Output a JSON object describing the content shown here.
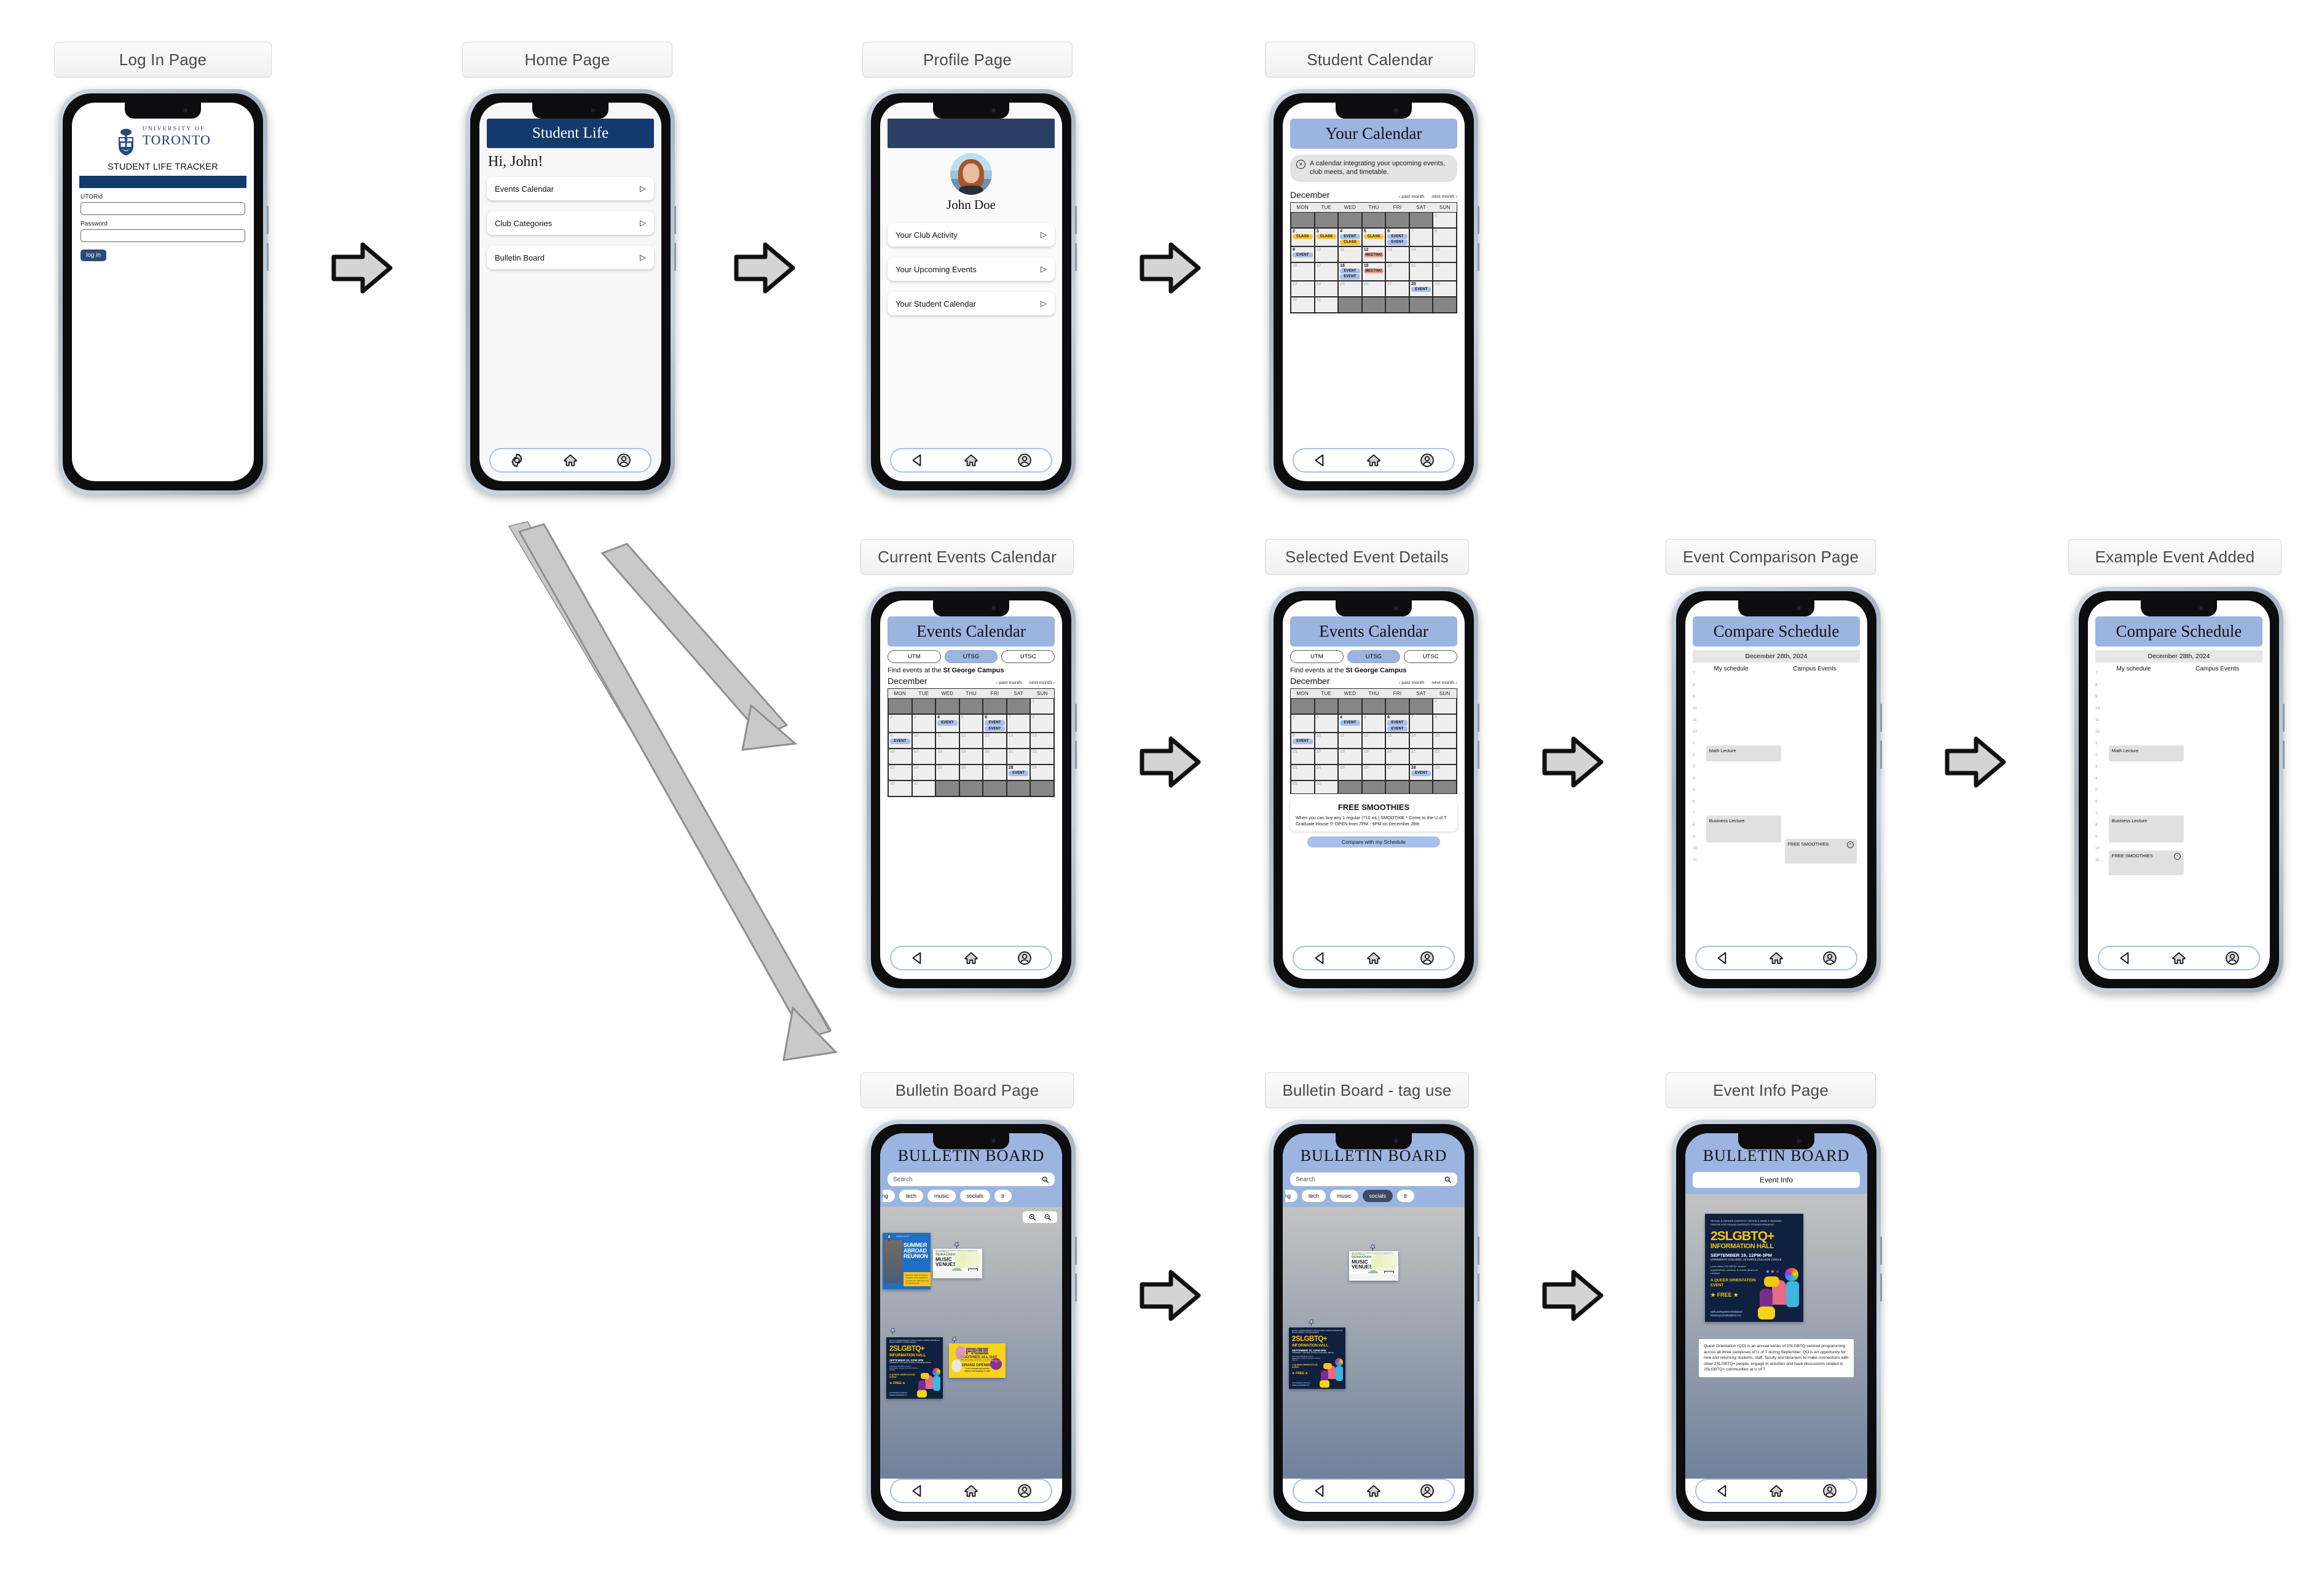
{
  "flow": {
    "labels": {
      "login": "Log In Page",
      "home": "Home Page",
      "profile": "Profile Page",
      "student_calendar": "Student Calendar",
      "current_events": "Current Events Calendar",
      "selected_event": "Selected Event Details",
      "event_comparison": "Event Comparison Page",
      "example_added": "Example Event Added",
      "bulletin": "Bulletin Board Page",
      "bulletin_tag": "Bulletin Board - tag use",
      "event_info": "Event Info Page"
    }
  },
  "login": {
    "university_line1": "UNIVERSITY OF",
    "university_line2": "TORONTO",
    "app_title": "STUDENT LIFE TRACKER",
    "utorid_label": "UTORid",
    "utorid_value": "",
    "password_label": "Password",
    "password_value": "",
    "login_button": "log in"
  },
  "home": {
    "header": "Student Life",
    "greeting": "Hi, John!",
    "items": [
      {
        "label": "Events Calendar"
      },
      {
        "label": "Club Categories"
      },
      {
        "label": "Bulletin Board"
      }
    ],
    "nav": [
      "gear-icon",
      "home-icon",
      "profile-icon"
    ]
  },
  "profile": {
    "name": "John Doe",
    "items": [
      {
        "label": "Your Club Activity"
      },
      {
        "label": "Your Upcoming Events"
      },
      {
        "label": "Your Student Calendar"
      }
    ]
  },
  "student_calendar": {
    "header": "Your Calendar",
    "note": "A calendar integrating your upcoming events, club meets, and timetable.",
    "month": "December",
    "prev": "‹ past month",
    "next": "next month ›",
    "dow": [
      "MON",
      "TUE",
      "WED",
      "THU",
      "FRI",
      "SAT",
      "SUN"
    ],
    "weeks": [
      [
        {
          "off": true
        },
        {
          "off": true
        },
        {
          "off": true
        },
        {
          "off": true
        },
        {
          "off": true
        },
        {
          "off": true
        },
        {
          "d": "1",
          "dim": true
        }
      ],
      [
        {
          "d": "2",
          "tags": [
            {
              "t": "CLASS",
              "k": "cl"
            }
          ]
        },
        {
          "d": "3",
          "tags": [
            {
              "t": "CLASS",
              "k": "cl"
            }
          ]
        },
        {
          "d": "4",
          "tags": [
            {
              "t": "EVENT",
              "k": "ev"
            },
            {
              "t": "CLASS",
              "k": "cl"
            }
          ]
        },
        {
          "d": "5",
          "tags": [
            {
              "t": "CLASS",
              "k": "cl"
            }
          ]
        },
        {
          "d": "6",
          "tags": [
            {
              "t": "EVENT",
              "k": "ev"
            },
            {
              "t": "EVENT",
              "k": "ev"
            }
          ]
        },
        {
          "d": "7",
          "dim": true
        },
        {
          "d": "8",
          "dim": true
        }
      ],
      [
        {
          "d": "9",
          "tags": [
            {
              "t": "EVENT",
              "k": "ev"
            }
          ]
        },
        {
          "d": "10",
          "dim": true
        },
        {
          "d": "11",
          "dim": true
        },
        {
          "d": "12",
          "tags": [
            {
              "t": "MEETING",
              "k": "mt"
            }
          ]
        },
        {
          "d": "13",
          "dim": true
        },
        {
          "d": "14",
          "dim": true
        },
        {
          "d": "15",
          "dim": true
        }
      ],
      [
        {
          "d": "16",
          "dim": true
        },
        {
          "d": "17",
          "dim": true
        },
        {
          "d": "18",
          "tags": [
            {
              "t": "EVENT",
              "k": "ev"
            },
            {
              "t": "EVENT",
              "k": "ev"
            }
          ]
        },
        {
          "d": "19",
          "tags": [
            {
              "t": "MEETING",
              "k": "mt"
            }
          ]
        },
        {
          "d": "20",
          "dim": true
        },
        {
          "d": "21",
          "dim": true
        },
        {
          "d": "22",
          "dim": true
        }
      ],
      [
        {
          "d": "23",
          "dim": true
        },
        {
          "d": "24",
          "dim": true
        },
        {
          "d": "25",
          "dim": true
        },
        {
          "d": "26",
          "dim": true
        },
        {
          "d": "27",
          "dim": true
        },
        {
          "d": "28",
          "tags": [
            {
              "t": "EVENT",
              "k": "ev"
            }
          ]
        },
        {
          "d": "29",
          "dim": true
        }
      ],
      [
        {
          "d": "30",
          "dim": true
        },
        {
          "d": "31",
          "dim": true
        },
        {
          "off": true
        },
        {
          "off": true
        },
        {
          "off": true
        },
        {
          "off": true
        },
        {
          "off": true
        }
      ]
    ]
  },
  "events_calendar": {
    "header": "Events Calendar",
    "campus_tabs": [
      "UTM",
      "UTSG",
      "UTSC"
    ],
    "selected_campus": "UTSG",
    "find_prefix": "Find events at the ",
    "campus_name": "St George Campus",
    "month": "December",
    "prev": "‹ past month",
    "next": "next month ›",
    "dow": [
      "MON",
      "TUE",
      "WED",
      "THU",
      "FRI",
      "SAT",
      "SUN"
    ],
    "weeks": [
      [
        {
          "off": true
        },
        {
          "off": true
        },
        {
          "off": true
        },
        {
          "off": true
        },
        {
          "off": true
        },
        {
          "off": true
        },
        {
          "d": "1",
          "dim": true
        }
      ],
      [
        {
          "d": "2",
          "dim": true
        },
        {
          "d": "3",
          "dim": true
        },
        {
          "d": "4",
          "tags": [
            {
              "t": "EVENT",
              "k": "ev"
            }
          ]
        },
        {
          "d": "5",
          "dim": true
        },
        {
          "d": "6",
          "tags": [
            {
              "t": "EVENT",
              "k": "ev"
            },
            {
              "t": "EVENT",
              "k": "ev"
            }
          ]
        },
        {
          "d": "7",
          "dim": true
        },
        {
          "d": "8",
          "dim": true
        }
      ],
      [
        {
          "d": "9",
          "dim": true,
          "tags": [
            {
              "t": "EVENT",
              "k": "ev"
            }
          ]
        },
        {
          "d": "10",
          "dim": true
        },
        {
          "d": "11",
          "dim": true
        },
        {
          "d": "12",
          "dim": true
        },
        {
          "d": "13",
          "dim": true
        },
        {
          "d": "14",
          "dim": true
        },
        {
          "d": "15",
          "dim": true
        }
      ],
      [
        {
          "d": "16",
          "dim": true
        },
        {
          "d": "17",
          "dim": true
        },
        {
          "d": "18",
          "dim": true
        },
        {
          "d": "19",
          "dim": true
        },
        {
          "d": "20",
          "dim": true
        },
        {
          "d": "21",
          "dim": true
        },
        {
          "d": "22",
          "dim": true
        }
      ],
      [
        {
          "d": "23",
          "dim": true
        },
        {
          "d": "24",
          "dim": true
        },
        {
          "d": "25",
          "dim": true
        },
        {
          "d": "26",
          "dim": true
        },
        {
          "d": "27",
          "dim": true
        },
        {
          "d": "28",
          "tags": [
            {
              "t": "EVENT",
              "k": "ev"
            }
          ]
        },
        {
          "d": "29",
          "dim": true
        }
      ],
      [
        {
          "d": "30",
          "dim": true
        },
        {
          "d": "31",
          "dim": true
        },
        {
          "off": true
        },
        {
          "off": true
        },
        {
          "off": true
        },
        {
          "off": true
        },
        {
          "off": true
        }
      ]
    ]
  },
  "selected_event": {
    "title": "FREE SMOOTHIES",
    "body": "When you can buy any 1 regular (710 mL) SMOOTHIE * Come to the U of T Graduate House !!! OPEN from 7PM - 9PM on December 28th",
    "compare_button": "Compare with my Schedule"
  },
  "compare": {
    "header": "Compare Schedule",
    "date": "December 28th, 2024",
    "col_mine": "My schedule",
    "col_campus": "Campus Events",
    "hours": [
      "7",
      "8",
      "9",
      "10",
      "11",
      "12",
      "1",
      "2",
      "3",
      "4",
      "5",
      "6",
      "7",
      "8",
      "9",
      "10",
      "11"
    ],
    "my_events": [
      {
        "label": "Math Lecture"
      },
      {
        "label": "Business Lecture"
      }
    ],
    "campus_events": [
      {
        "label": "FREE SMOOTHIES",
        "action": "+"
      }
    ],
    "added_events": [
      {
        "label": "FREE SMOOTHIES",
        "action": "−"
      }
    ]
  },
  "bulletin": {
    "header": "BULLETIN BOARD",
    "search_placeholder": "Search",
    "search_value": "",
    "tags": [
      "ing",
      "tech",
      "music",
      "socials",
      "tr"
    ],
    "selected_tag_board": "",
    "selected_tag_filtered": "socials",
    "zoom_in": "zoom-in-icon",
    "zoom_out": "zoom-out-icon",
    "posters": [
      {
        "id": "summer-abroad",
        "title_lines": [
          "SUMMER",
          "ABROAD",
          "REUNION"
        ],
        "kicker": "HIGHLIGHTS",
        "caption": "Students, staff, and faculty members come together to celebrate the 2023 Summer Abroad Reunion!"
      },
      {
        "id": "music-venues",
        "title_lines": [
          "MUSIC",
          "VENUES"
        ],
        "kicker": "REIMAGINING",
        "caption": "THE UNIVERSITY OF TORONTO SCHOOL OF CITIES AND THE VELOCITY PROJECT"
      },
      {
        "id": "lgbtq-info-hall",
        "presenter": "SEXUAL & GENDER DIVERSITY OFFICE & MARK S. BONHAM CENTRE FOR SEXUAL DIVERSITY STUDIES PRESENT",
        "title": "2SLGBTQ+",
        "subtitle": "INFORMATION HALL",
        "date": "SEPTEMBER 19, 12PM-3PM",
        "venue": "UNIVERSITY COLLEGE, 15 KING'S COLLEGE CIRCLE",
        "blurb": "Learn about 2SLGBTQ+ centred organizations, services, & events off and on campus!",
        "tagline": "A QUEER ORIENTATION EVENT",
        "free": "★ FREE ★",
        "url": "uoft.me/queerorientation",
        "email": "SGDO@UTORONTO.CA"
      },
      {
        "id": "free-smoothies",
        "title": "FREE",
        "subtitle": "SMOOTHIES ALL DAY",
        "fine": "WHEN YOU BUY ANY 1 REGULAR (710 mL) SMOOTHIE*",
        "fine2": "*Come to our lovely limited time event open, that opened a store on all option.",
        "grand": "GRAND OPENING",
        "venue": "U OF T GRADUATE HOUSE",
        "date": "FRIDAY, SEPTEMBER 6, 2024",
        "badge": "OPEN DAILY 7am - 9pm"
      }
    ]
  },
  "event_info": {
    "header": "BULLETIN BOARD",
    "button": "Event Info",
    "description": "Queer Orientation (QO) is an annual series of 2SLGBTQ-centred programming across all three campuses of U of T during September. QO is an opportunity for new and returning students, staff, faculty and librarians to make connections with other 2SLGBTQ+ people, engage in activities and have discussions related to 2SLGBTQ+ communities at U of T."
  }
}
